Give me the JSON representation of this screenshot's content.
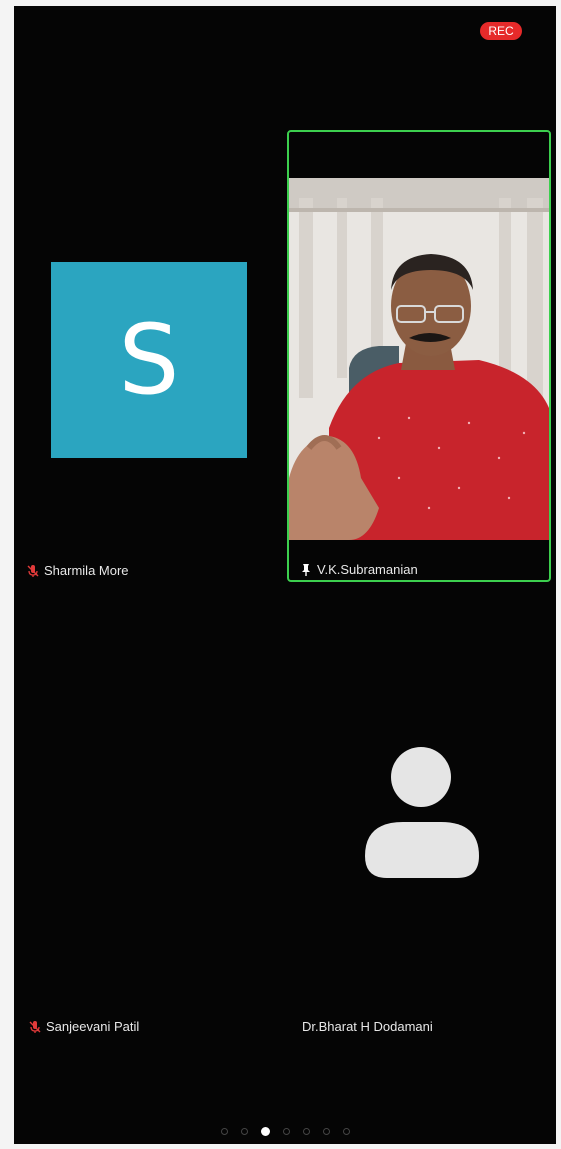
{
  "status": {
    "rec_label": "REC"
  },
  "tiles": [
    {
      "name": "Sharmila More",
      "avatar_letter": "S",
      "avatar_color": "#2ba5c0",
      "muted": true
    },
    {
      "name": "V.K.Subramanian",
      "active_speaker": true,
      "speaker_icon": "pin-icon"
    },
    {
      "name": "Sanjeevani Patil",
      "muted": true
    },
    {
      "name": "Dr.Bharat H Dodamani",
      "avatar": "default-person-icon"
    }
  ],
  "pager": {
    "page_count": 7,
    "current_page": 3
  },
  "colors": {
    "background": "#050505",
    "active_border": "#3ccf4e",
    "rec": "#e62a2a",
    "muted_icon": "#e23a3a"
  }
}
